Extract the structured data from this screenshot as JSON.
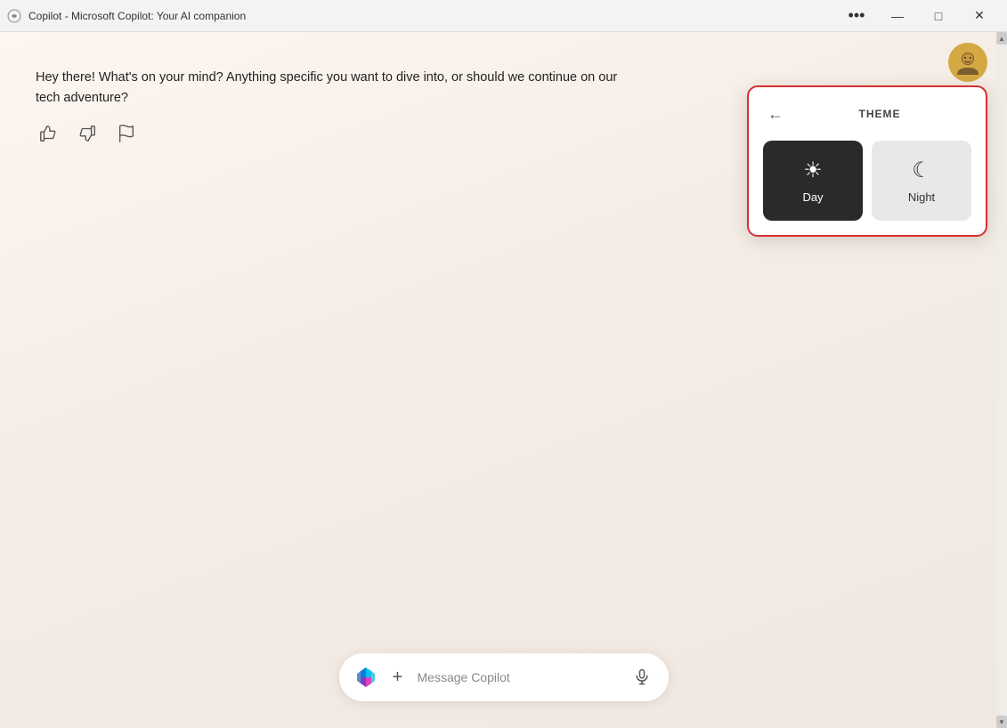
{
  "titlebar": {
    "title": "Copilot - Microsoft Copilot: Your AI companion",
    "more_label": "•••",
    "minimize_label": "—",
    "maximize_label": "□",
    "close_label": "✕"
  },
  "theme_popup": {
    "back_label": "←",
    "title": "THEME",
    "day_label": "Day",
    "night_label": "Night",
    "day_icon": "☀",
    "night_icon": "☾"
  },
  "message": {
    "text": "Hey there! What's on your mind? Anything specific you want to dive into, or should we continue on our tech adventure?"
  },
  "input": {
    "placeholder": "Message Copilot",
    "add_label": "+",
    "mic_label": "🎤"
  },
  "avatar": {
    "alt": "User avatar"
  },
  "actions": {
    "thumbs_up": "👍",
    "thumbs_down": "👎",
    "flag": "🚩"
  }
}
